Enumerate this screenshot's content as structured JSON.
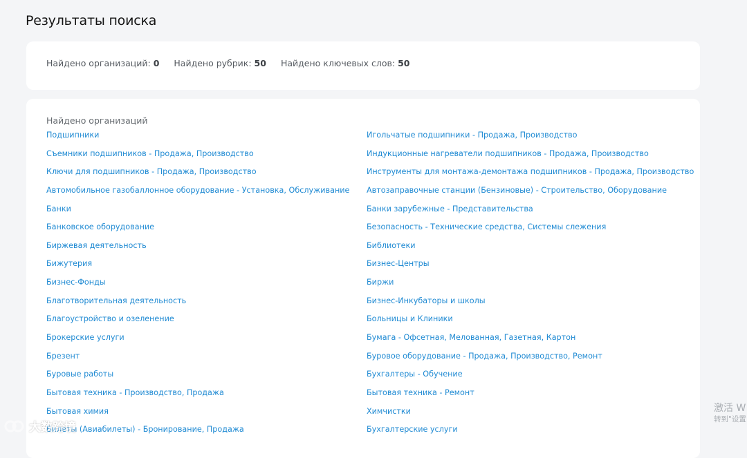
{
  "page": {
    "title": "Результаты поиска"
  },
  "stats": [
    {
      "label": "Найдено организаций:",
      "value": "0"
    },
    {
      "label": "Найдено рубрик:",
      "value": "50"
    },
    {
      "label": "Найдено ключевых слов:",
      "value": "50"
    }
  ],
  "results": {
    "heading": "Найдено организаций",
    "left": [
      "Подшипники",
      "Съемники подшипников - Продажа, Производство",
      "Ключи для подшипников - Продажа, Производство",
      "Автомобильное газобаллонное оборудование - Установка, Обслуживание",
      "Банки",
      "Банковское оборудование",
      "Биржевая деятельность",
      "Бижутерия",
      "Бизнес-Фонды",
      "Благотворительная деятельность",
      "Благоустройство и озеленение",
      "Брокерские услуги",
      "Брезент",
      "Буровые работы",
      "Бытовая техника - Производство, Продажа",
      "Бытовая химия",
      "Билеты (Авиабилеты) - Бронирование, Продажа"
    ],
    "right": [
      "Игольчатые подшипники - Продажа, Производство",
      "Индукционные нагреватели подшипников - Продажа, Производство",
      "Инструменты для монтажа-демонтажа подшипников - Продажа, Производство",
      "Автозаправочные станции (Бензиновые) - Строительство, Оборудование",
      "Банки зарубежные - Представительства",
      "Безопасность - Технические средства, Системы слежения",
      "Библиотеки",
      "Бизнес-Центры",
      "Биржи",
      "Бизнес-Инкубаторы и школы",
      "Больницы и Клиники",
      "Бумага - Офсетная, Мелованная, Газетная, Картон",
      "Буровое оборудование - Продажа, Производство, Ремонт",
      "Бухгалтеры - Обучение",
      "Бытовая техника - Ремонт",
      "Химчистки",
      "Бухгалтерские услуги"
    ]
  },
  "overlays": {
    "watermark_text": "大数跨境",
    "activate_line1": "激活 W",
    "activate_line2": "转到\"设置"
  }
}
